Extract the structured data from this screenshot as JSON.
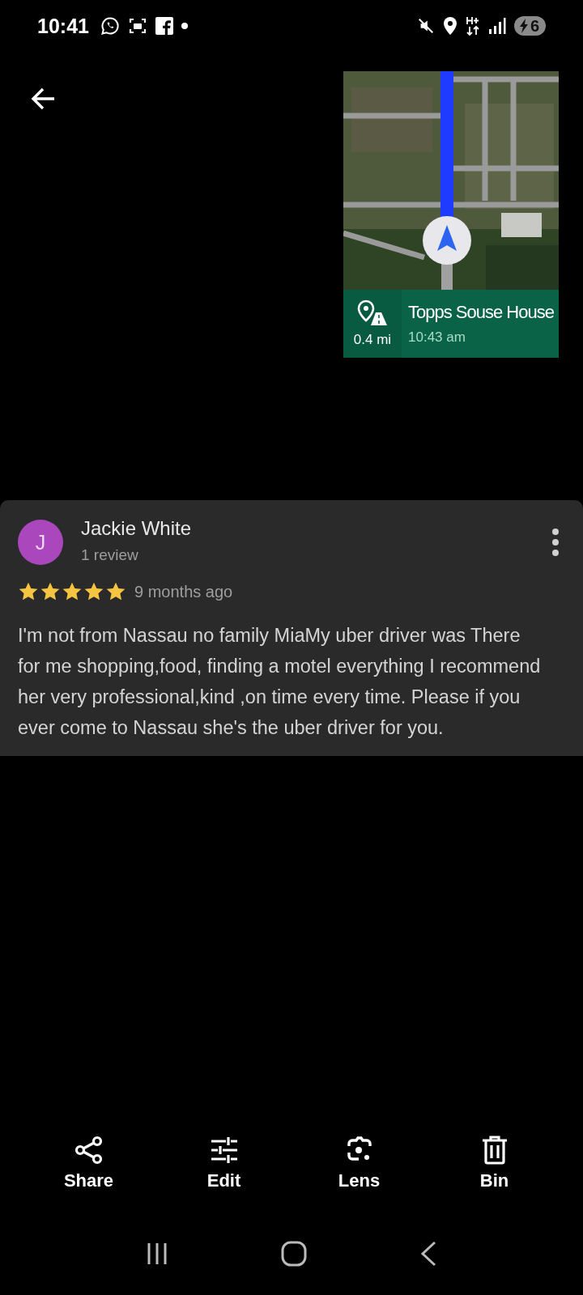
{
  "status_bar": {
    "time": "10:41",
    "battery": "6"
  },
  "navigation_card": {
    "destination": "Topps Souse House",
    "distance": "0.4 mi",
    "arrival": "10:43 am"
  },
  "review": {
    "avatar_letter": "J",
    "author": "Jackie White",
    "review_count": "1 review",
    "stars": 5,
    "time_ago": "9 months ago",
    "text": "I'm not from Nassau no family MiaMy uber driver was There for me shopping,food, finding a motel everything I recommend her very professional,kind ,on time every time. Please if you ever come to Nassau she's the uber driver for you."
  },
  "actions": [
    {
      "kind": "share",
      "label": "Share"
    },
    {
      "kind": "edit",
      "label": "Edit"
    },
    {
      "kind": "lens",
      "label": "Lens"
    },
    {
      "kind": "bin",
      "label": "Bin"
    }
  ]
}
